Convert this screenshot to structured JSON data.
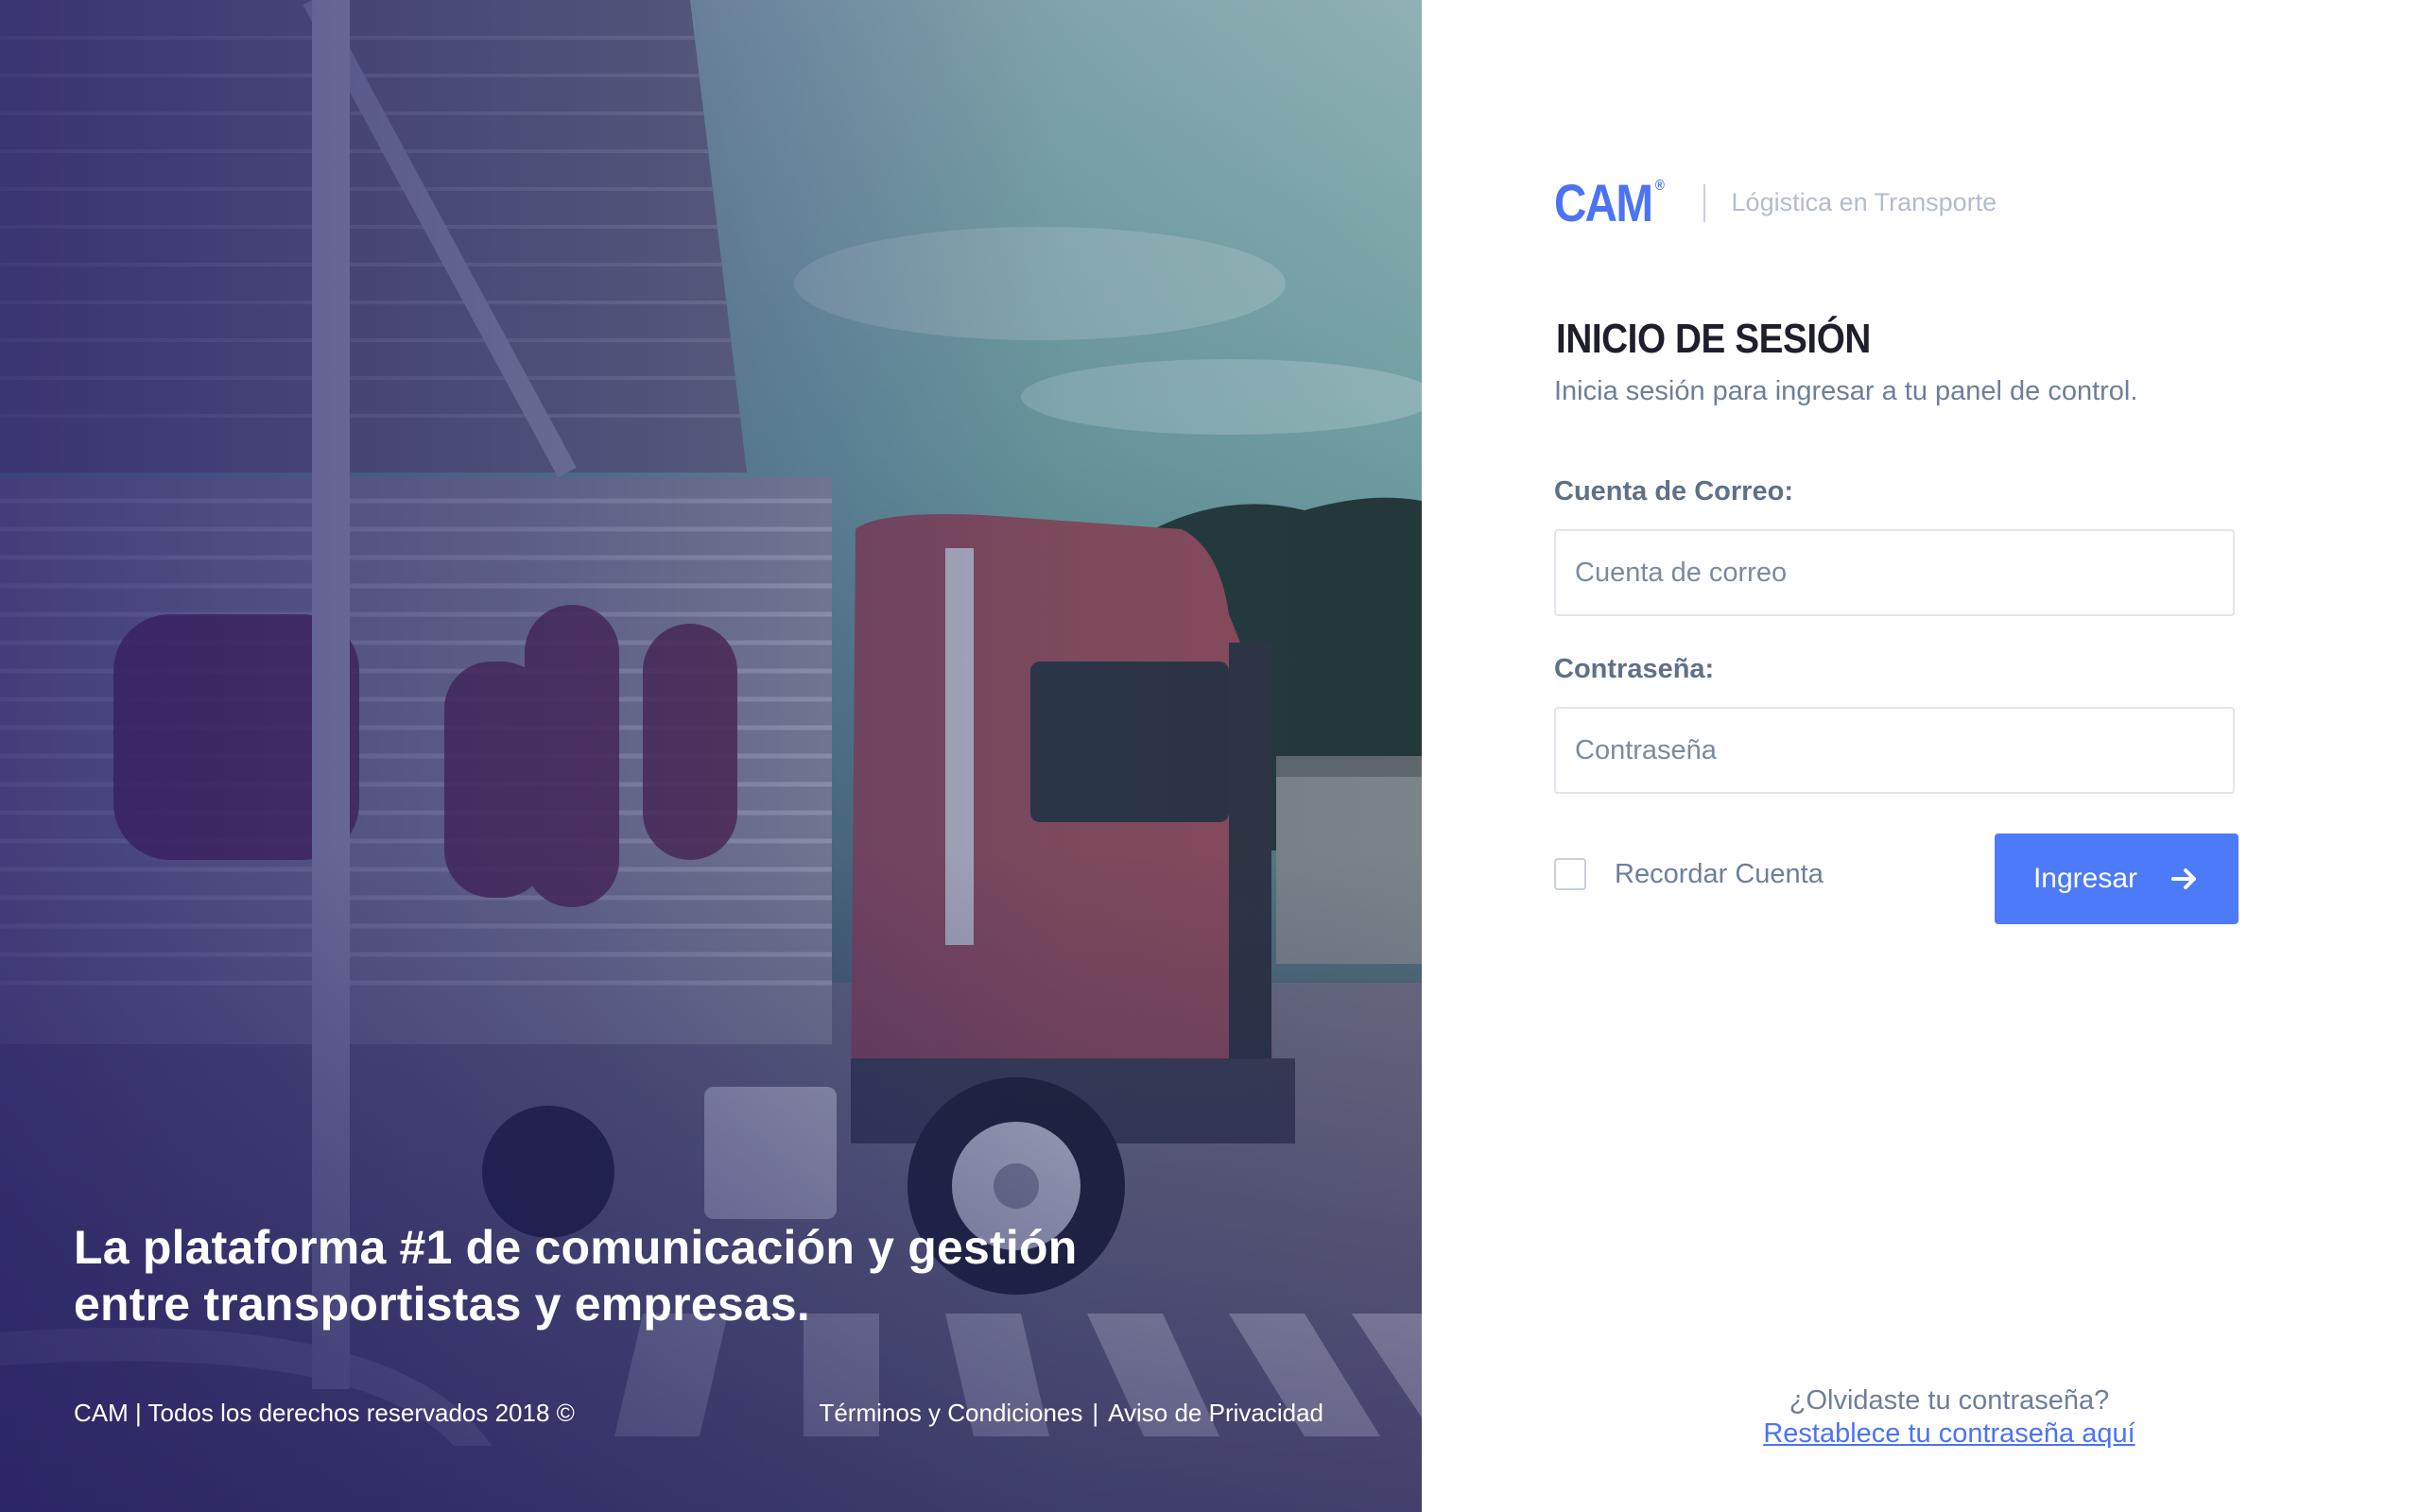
{
  "hero": {
    "tagline_line1": "La plataforma #1 de comunicación y gestión",
    "tagline_line2": "entre transportistas y empresas.",
    "copyright": "CAM | Todos los derechos reservados 2018 ©",
    "terms_link": "Términos y Condiciones",
    "links_separator": "|",
    "privacy_link": "Aviso de Privacidad"
  },
  "brand": {
    "logo": "CAM",
    "registered": "®",
    "subtitle": "Lógistica en Transporte"
  },
  "login": {
    "title": "INICIO DE SESIÓN",
    "subtitle": "Inicia sesión para ingresar a tu panel de control.",
    "email_label": "Cuenta de Correo:",
    "email_placeholder": "Cuenta de correo",
    "email_value": "",
    "password_label": "Contraseña:",
    "password_placeholder": "Contraseña",
    "password_value": "",
    "remember_label": "Recordar Cuenta",
    "remember_checked": false,
    "submit_label": "Ingresar",
    "submit_icon": "arrow-right-icon"
  },
  "forgot": {
    "question": "¿Olvidaste tu contraseña?",
    "reset_link": "Restablece tu contraseña aquí"
  },
  "colors": {
    "accent": "#4c7af8",
    "brand": "#4c73f5",
    "text_muted": "#6e7f9a",
    "title": "#1f1f2b"
  }
}
